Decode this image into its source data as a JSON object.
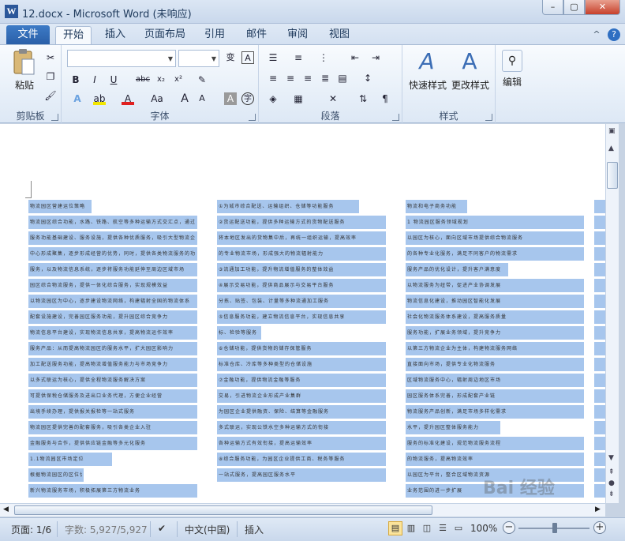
{
  "window": {
    "title": "12.docx - Microsoft Word (未响应)",
    "minimize": "–",
    "maximize": "▢",
    "close": "✕"
  },
  "tabs": {
    "file": "文件",
    "items": [
      "开始",
      "插入",
      "页面布局",
      "引用",
      "邮件",
      "审阅",
      "视图"
    ]
  },
  "ribbon": {
    "clipboard": {
      "paste": "粘贴",
      "label": "剪贴板"
    },
    "font": {
      "label": "字体",
      "font_name": "",
      "font_size": ""
    },
    "paragraph": {
      "label": "段落"
    },
    "styles": {
      "quick": "快速样式",
      "change": "更改样式",
      "label": "样式"
    },
    "editing": {
      "edit": "编辑"
    }
  },
  "status": {
    "page": "页面: 1/6",
    "words": "字数: 5,927/5,927",
    "language": "中文(中国)",
    "mode": "插入",
    "zoom": "100%"
  },
  "watermark": "Bai 经验",
  "document": {
    "col1": [
      "物流园区营建运位策略",
      "物流园区综合功能，水路、铁路、航空等多种运输方式交汇点，通过园区",
      "服务功能基础建设、服务设施，提供各种优质服务，吸引大型物流企业",
      "中心形成聚集，逐步形成经营的优势，同时，提供各类物流服务的功能",
      "服务，以及物流信息系统，逐步将服务功能延伸至周边区域市场",
      "园区综合物流服务，提供一体化综合服务，实现规模效益",
      "以物流园区为中心，逐步建设物流网络，构建辐射全国的物流体系",
      "配套设施建设，完善园区服务功能，提升园区综合竞争力",
      "物流信息平台建设，实现物流信息共享，提高物流运作效率",
      "服务产品：从而提高物流园区的服务水平，扩大园区影响力",
      "加工配送服务功能，提高物流增值服务能力与市场竞争力",
      "以多式联运为核心，提供全程物流服务解决方案",
      "可提供保税仓储服务及进出口业务代理，方便企业经营",
      "出境手续办理，提供报关报检等一站式服务",
      "物流园区提供完善的配套服务，吸引各类企业入驻",
      "金融服务与合作，提供供应链金融等多元化服务",
      "1.1物流园区市场定位",
      "根据物流园区的区位优势和功能定位，确定目标市场",
      "新兴物流服务市场，积极拓展第三方物流业务"
    ],
    "col2": [
      "①为城市综合配送、运输组织、仓储等功能服务",
      "②货运配送功能，提供多种运输方式的货物配送服务",
      "将本地区发出的货物集中后，再统一组织运输，提高效率",
      "的专业物流市场，形成强大的物流辐射能力",
      "③流通加工功能，提升物流增值服务的整体效益",
      "④展示交易功能，提供商品展示与交易平台服务",
      "分拣、贴签、包装、计量等多种流通加工服务",
      "⑤信息服务功能，建立物流信息平台，实现信息共享",
      "标、检验等服务",
      "⑥仓储功能，提供货物的储存保管服务",
      "标准仓库、冷库等多种类型的仓储设施",
      "⑦金融功能，提供物流金融等服务",
      "交易，引进物流企业形成产业集群",
      "为园区企业提供融资、保险、结算等金融服务",
      "多式联运，实现公铁水空多种运输方式的衔接",
      "各种运输方式有效衔接，提高运输效率",
      "⑧综合服务功能，为园区企业提供工商、税务等服务",
      "一站式服务，提高园区服务水平"
    ],
    "col3": [
      "物流和电子商务功能",
      "1 物流园区服务领域规划",
      "以园区为核心，面向区域市场提供综合物流服务",
      "的各种专业化服务，满足不同客户的物流需求",
      "服务产品的优化设计，提升客户满意度",
      "以物流服务为纽带，促进产业协调发展",
      "物流信息化建设，推动园区智能化发展",
      "社会化物流服务体系建设，提高服务质量",
      "服务功能，扩展业务领域，提升竞争力",
      "以第三方物流企业为主体，构建物流服务网络",
      "直接面向市场，提供专业化物流服务",
      "区域物流服务中心，辐射周边地区市场",
      "园区服务体系完善，形成配套产业链",
      "物流服务产品创新，满足市场多样化需求",
      "水平，提升园区整体服务能力",
      "服务的标准化建设，规范物流服务流程",
      "的物流服务，提高物流效率",
      "以园区为平台，整合区域物流资源",
      "业务范围的进一步扩展"
    ]
  }
}
